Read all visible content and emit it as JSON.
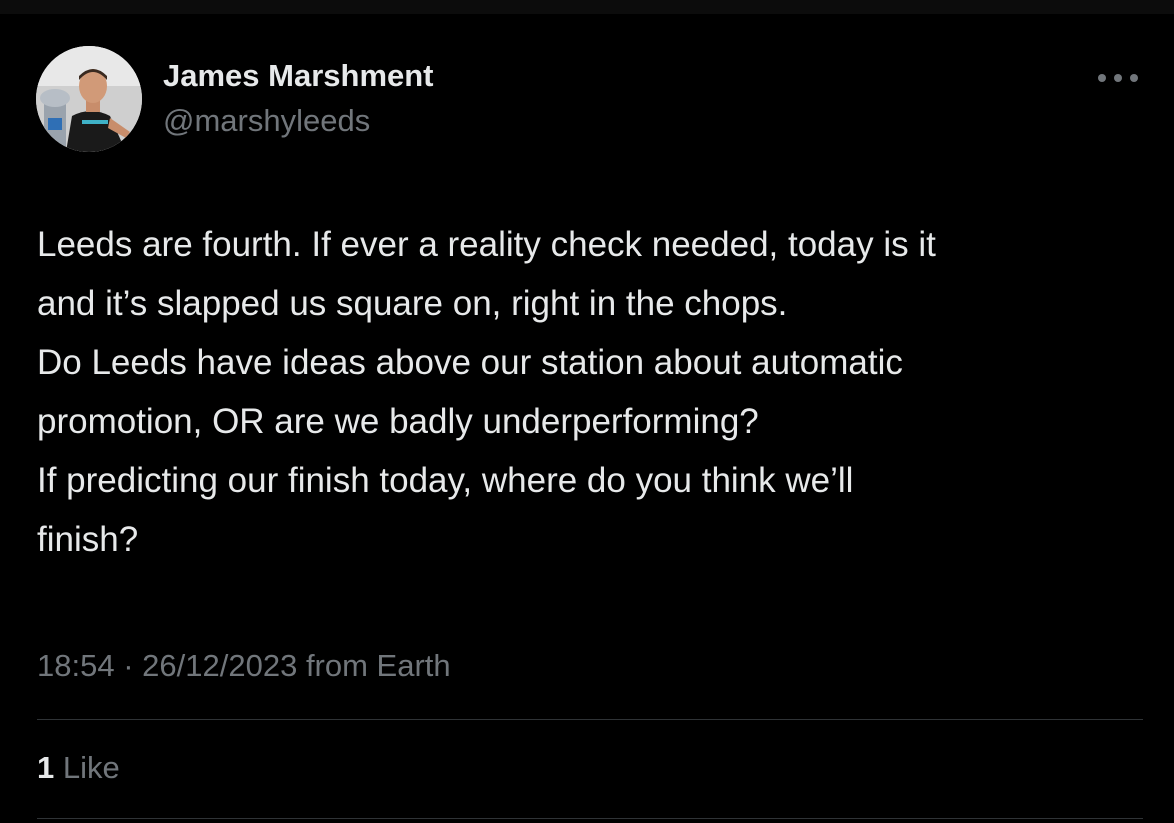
{
  "author": {
    "name": "James Marshment",
    "handle": "@marshyleeds",
    "avatar_icon": "profile-photo"
  },
  "tweet": {
    "lines": [
      "Leeds are fourth. If ever a reality check needed, today is it",
      "and it’s slapped us square on, right in the chops.",
      "Do Leeds have ideas above our station about automatic",
      "promotion, OR are we badly underperforming?",
      "If predicting our finish today, where do you think we’ll",
      "finish?"
    ]
  },
  "meta": {
    "time": "18:54",
    "separator": "·",
    "date": "26/12/2023",
    "source": "from Earth"
  },
  "engagement": {
    "like_count": "1",
    "like_label": "Like"
  },
  "icons": {
    "more": "more-horizontal-icon"
  },
  "colors": {
    "background": "#000000",
    "primary_text": "#e7e9ea",
    "secondary_text": "#71767b",
    "divider": "#2f3336"
  }
}
